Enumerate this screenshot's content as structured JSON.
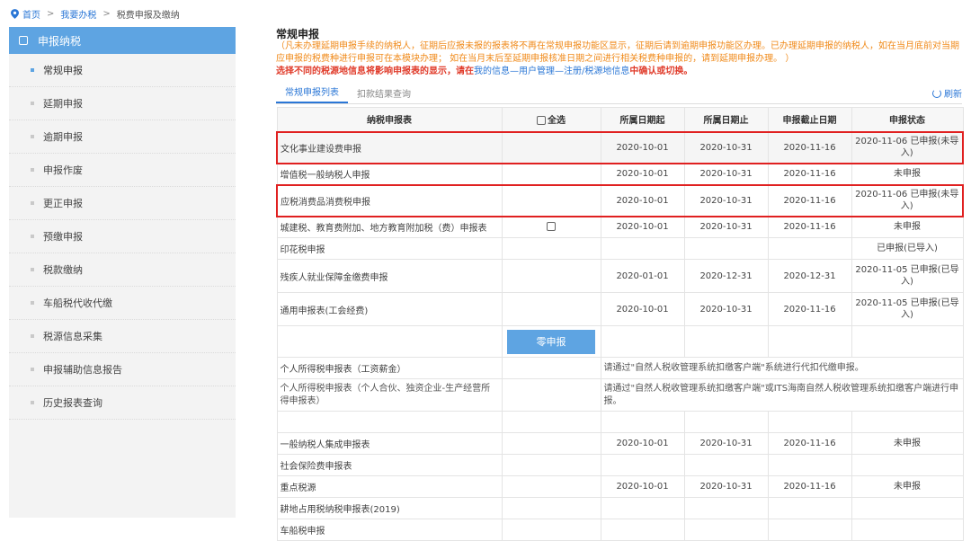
{
  "breadcrumb": {
    "home": "首页",
    "sep1": ">",
    "level2": "我要办税",
    "sep2": ">",
    "current": "税费申报及缴纳"
  },
  "sidebar": {
    "header": "申报纳税",
    "items": [
      "常规申报",
      "延期申报",
      "逾期申报",
      "申报作废",
      "更正申报",
      "预缴申报",
      "税款缴纳",
      "车船税代收代缴",
      "税源信息采集",
      "申报辅助信息报告",
      "历史报表查询"
    ]
  },
  "main": {
    "title": "常规申报",
    "notice1": "（凡未办理延期申报手续的纳税人，征期后应报未报的报表将不再在常规申报功能区显示，征期后请到逾期申报功能区办理。已办理延期申报的纳税人，如在当月底前对当期应申报的税费种进行申报可在本模块办理； 如在当月末后至延期申报核准日期之间进行相关税费种申报的，请到延期申报办理。 ）",
    "notice2_pre": "选择不同的税源地信息将影响申报表的显示，请在",
    "notice2_link": "我的信息—用户管理—注册/税源地信息",
    "notice2_post": "中确认或切换。",
    "tabs": [
      "常规申报列表",
      "扣款结果查询"
    ],
    "refresh": "刷新"
  },
  "table": {
    "headers": {
      "name": "纳税申报表",
      "select_all": "全选",
      "start": "所属日期起",
      "end": "所属日期止",
      "deadline": "申报截止日期",
      "status": "申报状态"
    },
    "rows": [
      {
        "name": "文化事业建设费申报",
        "check": false,
        "start": "2020-10-01",
        "end": "2020-10-31",
        "deadline": "2020-11-16",
        "status": "2020-11-06 已申报(未导入)",
        "highlight": true
      },
      {
        "name": "增值税一般纳税人申报",
        "check": false,
        "start": "2020-10-01",
        "end": "2020-10-31",
        "deadline": "2020-11-16",
        "status": "未申报"
      },
      {
        "name": "应税消费品消费税申报",
        "check": false,
        "start": "2020-10-01",
        "end": "2020-10-31",
        "deadline": "2020-11-16",
        "status": "2020-11-06 已申报(未导入)",
        "highlight": true
      },
      {
        "name": "城建税、教育费附加、地方教育附加税（费）申报表",
        "check": true,
        "start": "2020-10-01",
        "end": "2020-10-31",
        "deadline": "2020-11-16",
        "status": "未申报"
      },
      {
        "name": "印花税申报",
        "check": false,
        "start": "",
        "end": "",
        "deadline": "",
        "status": "已申报(已导入)"
      },
      {
        "name": "残疾人就业保障金缴费申报",
        "check": false,
        "start": "2020-01-01",
        "end": "2020-12-31",
        "deadline": "2020-12-31",
        "status": "2020-11-05 已申报(已导入)"
      },
      {
        "name": "通用申报表(工会经费)",
        "check": false,
        "start": "2020-10-01",
        "end": "2020-10-31",
        "deadline": "2020-11-16",
        "status": "2020-11-05 已申报(已导入)"
      }
    ],
    "zero_button": "零申报",
    "iit_rows": [
      {
        "name": "个人所得税申报表（工资薪金）",
        "note": "请通过\"自然人税收管理系统扣缴客户端\"系统进行代扣代缴申报。"
      },
      {
        "name": "个人所得税申报表（个人合伙、独资企业-生产经营所得申报表）",
        "note": "请通过\"自然人税收管理系统扣缴客户端\"或ITS海南自然人税收管理系统扣缴客户端进行申报。"
      }
    ],
    "rows2": [
      {
        "name": "",
        "start": "",
        "end": "",
        "deadline": "",
        "status": ""
      },
      {
        "name": "一般纳税人集成申报表",
        "start": "2020-10-01",
        "end": "2020-10-31",
        "deadline": "2020-11-16",
        "status": "未申报"
      },
      {
        "name": "社会保险费申报表",
        "start": "",
        "end": "",
        "deadline": "",
        "status": ""
      },
      {
        "name": "重点税源",
        "start": "2020-10-01",
        "end": "2020-10-31",
        "deadline": "2020-11-16",
        "status": "未申报"
      },
      {
        "name": "耕地占用税纳税申报表(2019)",
        "start": "",
        "end": "",
        "deadline": "",
        "status": ""
      },
      {
        "name": "车船税申报",
        "start": "",
        "end": "",
        "deadline": "",
        "status": ""
      }
    ]
  }
}
